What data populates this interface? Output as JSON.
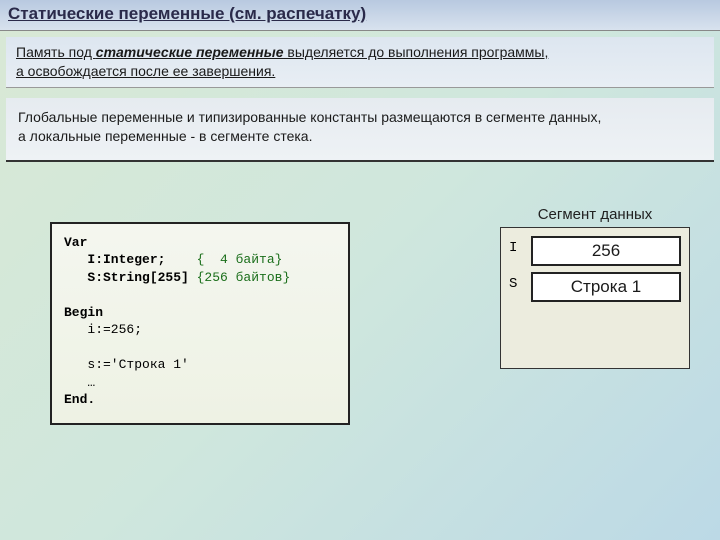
{
  "title": "Статические переменные (см. распечатку)",
  "box1": {
    "p1a": "Память под ",
    "p1b": "статические переменные",
    "p1c": " выделяется  до выполнения программы,",
    "p2": "а освобождается после ее завершения."
  },
  "box2": {
    "line1a": "Глобальные переменные и ",
    "line1b": "типизированные константы",
    "line1c": " размещаются в сегменте данных,",
    "line2": "а локальные  переменные - в сегменте стека."
  },
  "code": {
    "l1": "Var",
    "l2a": "   I:Integer;    ",
    "l2b": "{  4 байта}",
    "l3a": "   S:String[255] ",
    "l3b": "{256 байтов}",
    "l4": "",
    "l5": "Begin",
    "l6": "   i:=256;",
    "l7": "",
    "l8": "   s:='Строка 1'",
    "l9": "   …",
    "l10": "End."
  },
  "segment": {
    "title": "Сегмент данных",
    "rows": [
      {
        "label": "I",
        "value": "256"
      },
      {
        "label": "S",
        "value": "Строка 1"
      }
    ]
  }
}
